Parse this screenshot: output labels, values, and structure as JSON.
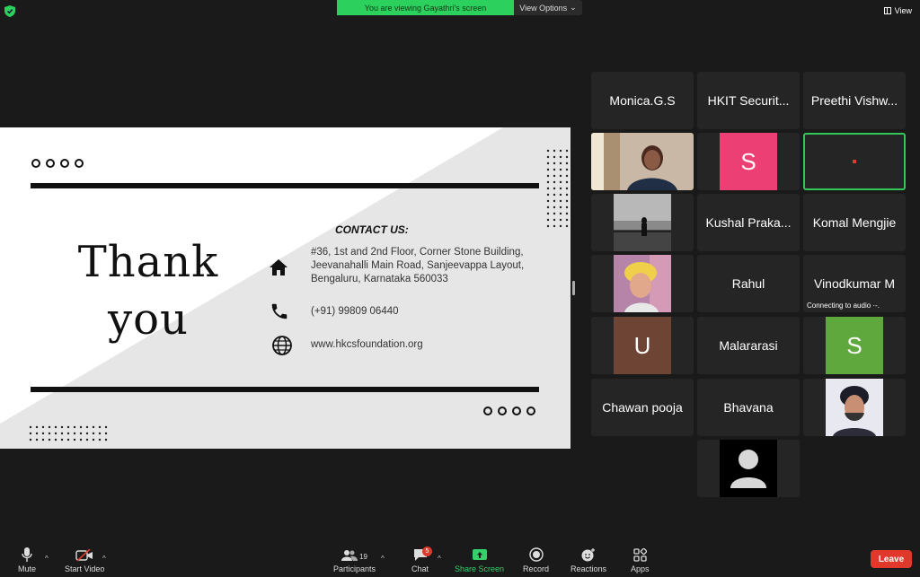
{
  "top": {
    "banner": "You are viewing Gayathri's screen",
    "view_options": "View Options",
    "view": "View"
  },
  "slide": {
    "thank": "Thank",
    "you": "you",
    "contact_heading": "CONTACT US:",
    "address": "#36, 1st and 2nd Floor, Corner Stone Building, Jeevanahalli Main Road, Sanjeevappa Layout, Bengaluru, Karnataka 560033",
    "phone": "(+91) 99809 06440",
    "website": "www.hkcsfoundation.org"
  },
  "participants": [
    {
      "name": "Monica.G.S"
    },
    {
      "name": "HKIT Securit..."
    },
    {
      "name": "Preethi Vishw..."
    },
    {
      "name": "",
      "avatar": "photo-woman"
    },
    {
      "name": "",
      "initial": "S",
      "color": "#ec3f73"
    },
    {
      "name": "",
      "status": "active-speaker-red-dot"
    },
    {
      "name": "",
      "avatar": "photo-silhouette"
    },
    {
      "name": "Kushal Praka..."
    },
    {
      "name": "Komal Mengjie"
    },
    {
      "name": "",
      "avatar": "photo-pink"
    },
    {
      "name": "Rahul"
    },
    {
      "name": "Vinodkumar M",
      "status_text": "Connecting to audio"
    },
    {
      "name": "",
      "initial": "U",
      "color": "#6e4434"
    },
    {
      "name": "Malararasi"
    },
    {
      "name": "",
      "initial": "S",
      "color": "#5fa83e"
    },
    {
      "name": "Chawan pooja"
    },
    {
      "name": "Bhavana"
    },
    {
      "name": "",
      "avatar": "photo-man"
    },
    {
      "name": "",
      "avatar": "default-user"
    }
  ],
  "toolbar": {
    "mute": "Mute",
    "start_video": "Start Video",
    "participants": "Participants",
    "participants_count": "19",
    "chat": "Chat",
    "chat_badge": "5",
    "share_screen": "Share Screen",
    "record": "Record",
    "reactions": "Reactions",
    "apps": "Apps",
    "leave": "Leave"
  },
  "colors": {
    "accent_green": "#2bd15c",
    "leave_red": "#e0392b"
  }
}
